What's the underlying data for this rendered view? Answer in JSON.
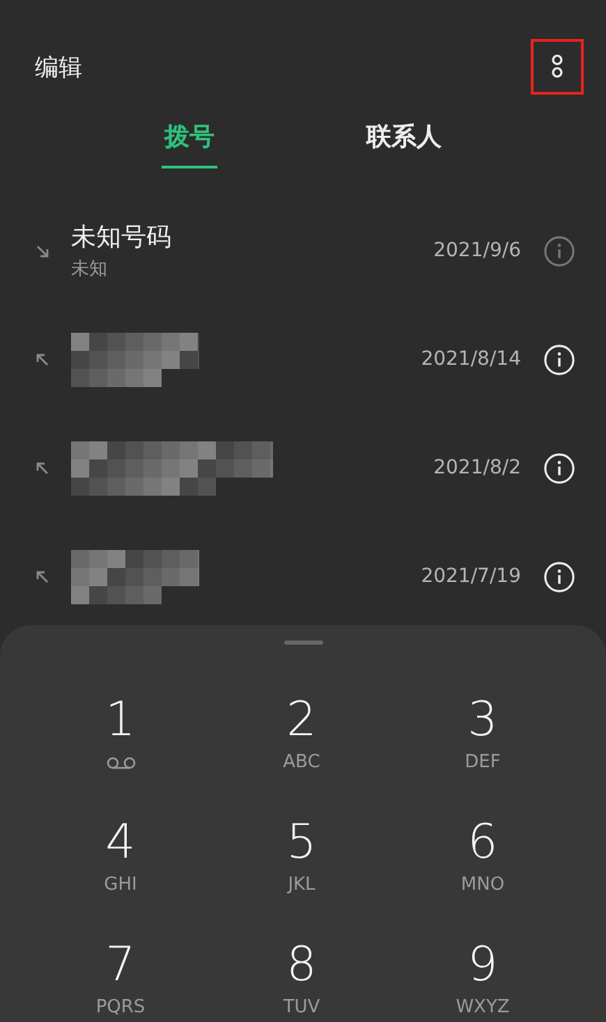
{
  "header": {
    "edit": "编辑",
    "menu": {
      "highlighted": true
    }
  },
  "tabs": [
    {
      "label": "拨号",
      "selected": true
    },
    {
      "label": "联系人",
      "selected": false
    }
  ],
  "calls": [
    {
      "kind": "incoming",
      "name": "未知号码",
      "subtitle": "未知",
      "date": "2021/9/6",
      "redacted": false
    },
    {
      "kind": "outgoing",
      "date": "2021/8/14",
      "redacted": true
    },
    {
      "kind": "outgoing",
      "date": "2021/8/2",
      "redacted": true
    },
    {
      "kind": "outgoing",
      "date": "2021/7/19",
      "redacted": true
    }
  ],
  "keypad": [
    {
      "digit": "1",
      "kind": "voicemail"
    },
    {
      "digit": "2",
      "letters": "ABC",
      "kind": "letters"
    },
    {
      "digit": "3",
      "letters": "DEF",
      "kind": "letters"
    },
    {
      "digit": "4",
      "letters": "GHI",
      "kind": "letters"
    },
    {
      "digit": "5",
      "letters": "JKL",
      "kind": "letters"
    },
    {
      "digit": "6",
      "letters": "MNO",
      "kind": "letters"
    },
    {
      "digit": "7",
      "letters": "PQRS",
      "kind": "letters"
    },
    {
      "digit": "8",
      "letters": "TUV",
      "kind": "letters"
    },
    {
      "digit": "9",
      "letters": "WXYZ",
      "kind": "letters"
    }
  ]
}
